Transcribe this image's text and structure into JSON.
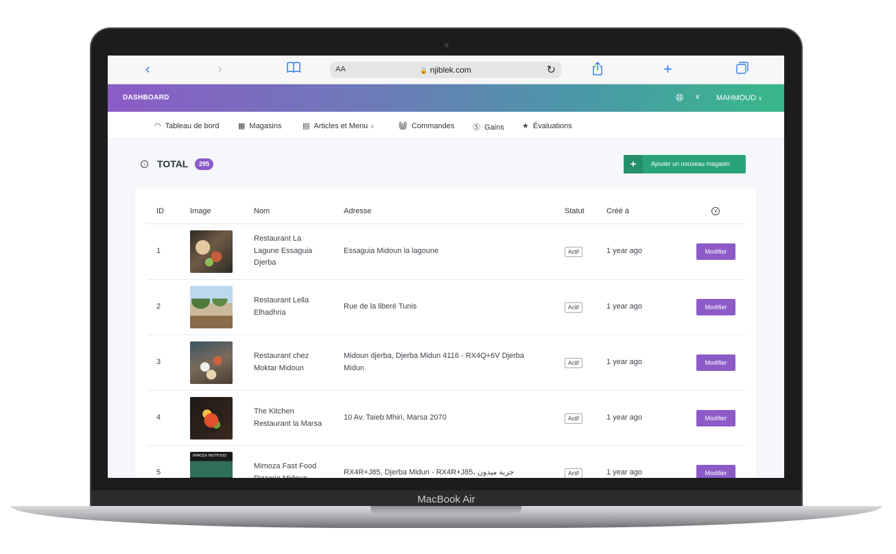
{
  "device": {
    "label": "MacBook Air"
  },
  "browser": {
    "aa_label": "AA",
    "url": "njiblek.com",
    "icons": [
      "back-icon",
      "forward-icon",
      "bookmarks-icon",
      "lock-icon",
      "reload-icon",
      "share-icon",
      "new-tab-icon",
      "tabs-icon"
    ]
  },
  "header": {
    "brand": "DASHBOARD",
    "user": "MAHMOUD",
    "colors": {
      "gradient_start": "#8b5bc6",
      "gradient_end": "#38b889"
    }
  },
  "nav": {
    "items": [
      {
        "label": "Tableau de bord",
        "icon": "gauge-icon"
      },
      {
        "label": "Magasins",
        "icon": "store-icon"
      },
      {
        "label": "Articles et Menu",
        "icon": "menu-icon",
        "has_dropdown": true
      },
      {
        "label": "Commandes",
        "icon": "basket-icon"
      },
      {
        "label": "Gains",
        "icon": "coin-icon"
      },
      {
        "label": "Évaluations",
        "icon": "star-icon"
      }
    ]
  },
  "summary": {
    "total_label": "TOTAL",
    "total_count": "295",
    "add_button": "Ajouter un nouveau magasin"
  },
  "table": {
    "columns": [
      "ID",
      "Image",
      "Nom",
      "Adresse",
      "Statut",
      "Créé à"
    ],
    "edit_label": "Modifier",
    "rows": [
      {
        "id": "1",
        "name": "Restaurant La Lagune Essaguia Djerba",
        "address": "Essaguia Midoun la lagoune",
        "status": "Actif",
        "created": "1 year ago"
      },
      {
        "id": "2",
        "name": "Restaurant Lella Elhadhria",
        "address": "Rue de la liberé Tunis",
        "status": "Actif",
        "created": "1 year ago"
      },
      {
        "id": "3",
        "name": "Restaurant chez Moktar Midoun",
        "address": "Midoun djerba, Djerba Midun 4116 - RX4Q+6V Djerba Midun",
        "status": "Actif",
        "created": "1 year ago"
      },
      {
        "id": "4",
        "name": "The Kitchen Restaurant la Marsa",
        "address": "10 Av. Taieb Mhiri, Marsa 2070",
        "status": "Actif",
        "created": "1 year ago"
      },
      {
        "id": "5",
        "name": "Mimoza Fast Food Pizzaria Midoun",
        "address": "RX4R+J85, Djerba Midun - RX4R+J85، جربة ميدون",
        "status": "Actif",
        "created": "1 year ago"
      }
    ]
  }
}
